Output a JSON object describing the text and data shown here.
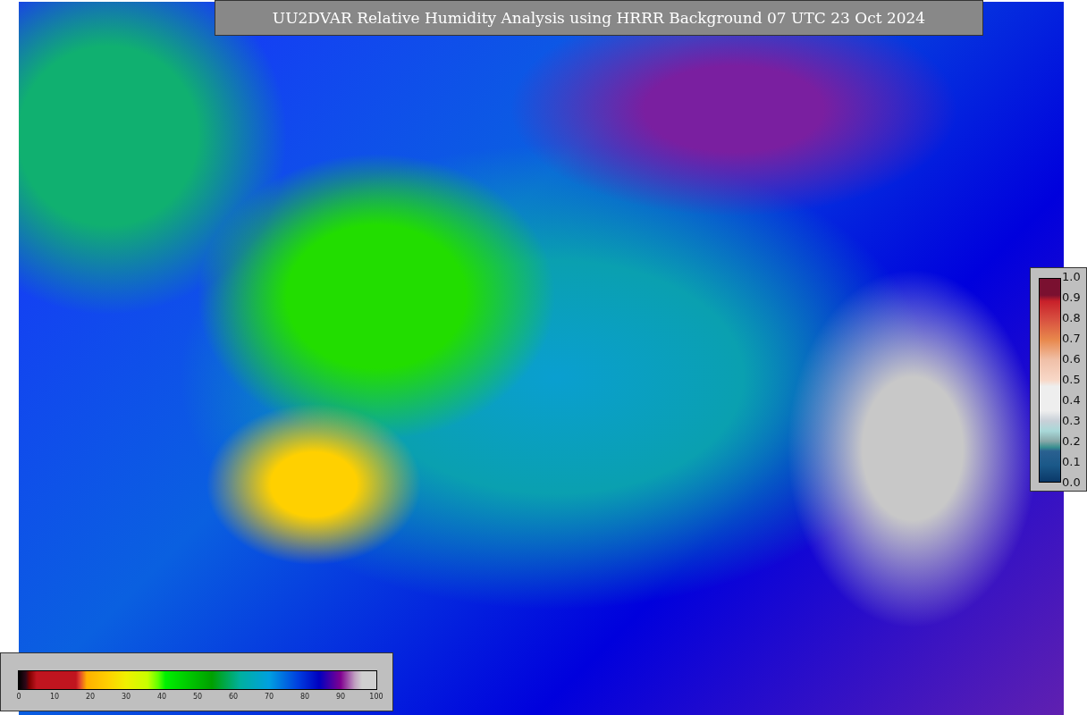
{
  "title": "UU2DVAR Relative Humidity Analysis using HRRR Background 07 UTC 23 Oct 2024",
  "humidity_colorbar": {
    "ticks": [
      "0",
      "10",
      "20",
      "30",
      "40",
      "50",
      "60",
      "70",
      "80",
      "90",
      "100"
    ]
  },
  "observation_colorbar": {
    "ticks": [
      "1.0",
      "0.9",
      "0.8",
      "0.7",
      "0.6",
      "0.5",
      "0.4",
      "0.3",
      "0.2",
      "0.1",
      "0.0"
    ]
  }
}
